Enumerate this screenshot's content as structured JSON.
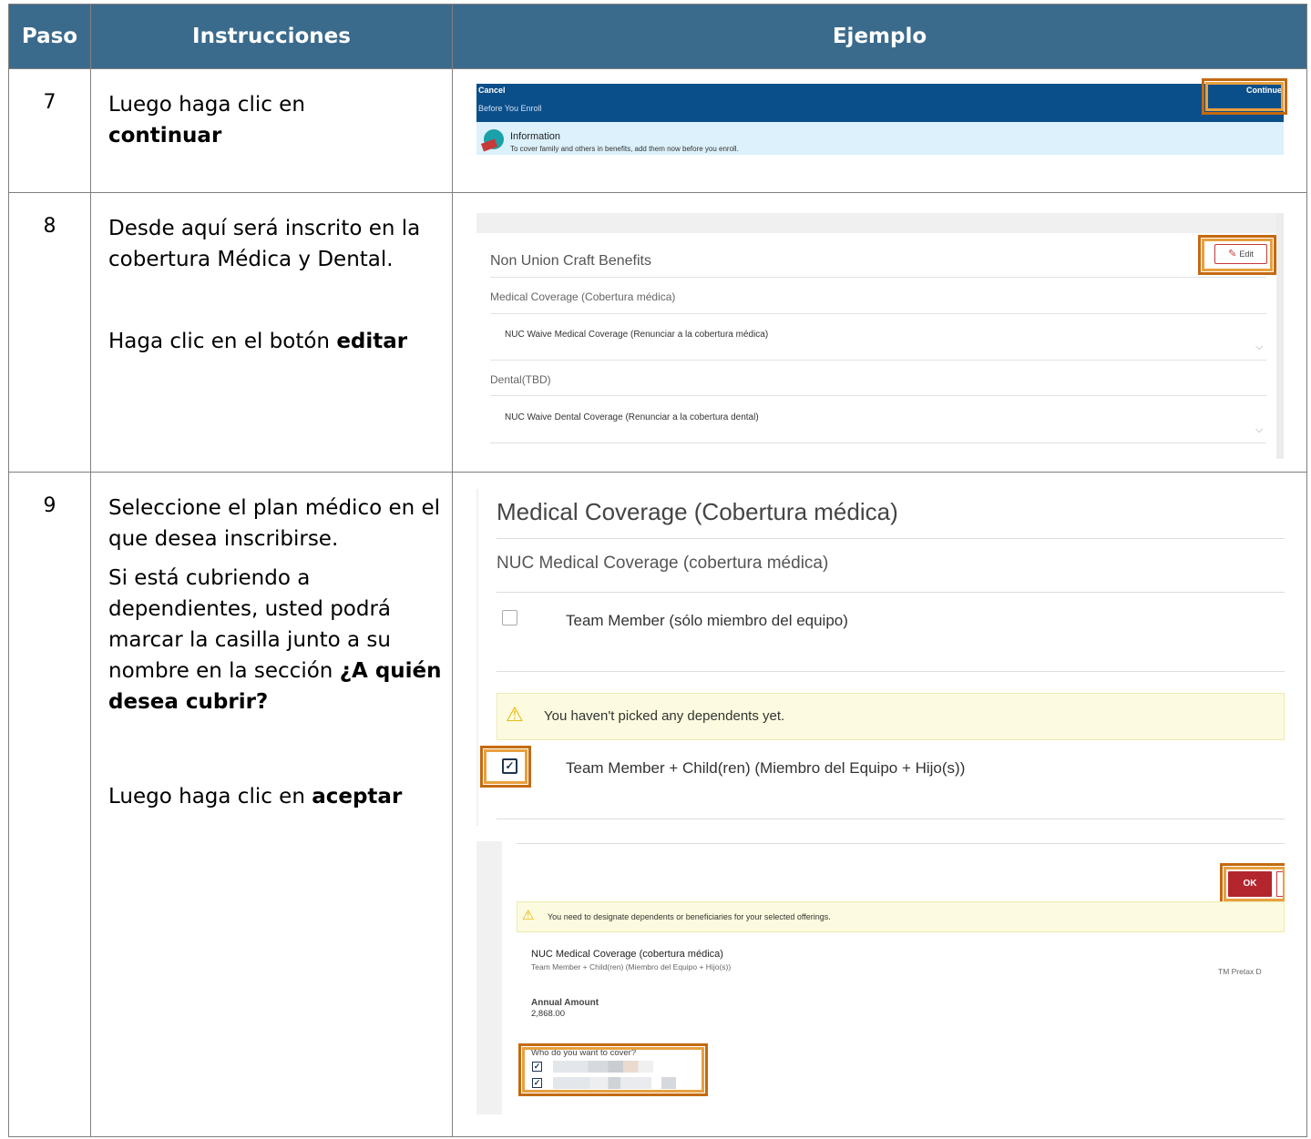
{
  "header": {
    "col_step": "Paso",
    "col_instructions": "Instrucciones",
    "col_example": "Ejemplo"
  },
  "rows": [
    {
      "step": "7",
      "instructions": {
        "line1": "Luego haga clic en",
        "bold": "continuar"
      }
    },
    {
      "step": "8",
      "instructions": {
        "para1": "Desde aquí será inscrito en la cobertura Médica y Dental.",
        "lead": "Haga clic en el botón",
        "bold": "editar"
      }
    },
    {
      "step": "9",
      "instructions": {
        "para1": "Seleccione el plan médico en el que desea inscribirse.",
        "para2_lead": "Si está cubriendo a dependientes, usted podrá marcar la casilla junto a su nombre en la sección",
        "para2_bold": "¿A quién desea cubrir?",
        "para3_lead": "Luego haga clic en",
        "para3_bold": "aceptar"
      }
    }
  ],
  "shot7": {
    "cancel": "Cancel",
    "continue": "Continue",
    "before_enroll": "Before You Enroll",
    "info_title": "Information",
    "info_text": "To cover family and others in benefits, add them now before you enroll."
  },
  "shot8": {
    "title": "Non Union Craft Benefits",
    "edit_label": "Edit",
    "medical_section": "Medical Coverage (Cobertura médica)",
    "medical_item": "NUC Waive Medical Coverage (Renunciar a la cobertura médica)",
    "dental_section": "Dental(TBD)",
    "dental_item": "NUC Waive Dental Coverage (Renunciar a la cobertura dental)"
  },
  "shot9a": {
    "heading": "Medical Coverage (Cobertura médica)",
    "plan": "NUC Medical Coverage (cobertura médica)",
    "option1": "Team Member (sólo miembro del equipo)",
    "warning": "You haven't picked any dependents yet.",
    "option2": "Team Member + Child(ren) (Miembro del Equipo + Hijo(s))",
    "option1_checked": false,
    "option2_checked": true
  },
  "shot9b": {
    "ok_label": "OK",
    "warning": "You need to designate dependents or beneficiaries for your selected offerings.",
    "plan": "NUC Medical Coverage (cobertura médica)",
    "tier": "Team Member + Child(ren) (Miembro del Equipo + Hijo(s))",
    "pretax": "TM Pretax D",
    "amount_label": "Annual Amount",
    "amount": "2,868.00",
    "who_label": "Who do you want to cover?"
  },
  "colors": {
    "header_bg": "#3b6b8c",
    "highlight": "#c46a10",
    "nav_blue": "#0b4f8a",
    "ok_red": "#b3262e"
  }
}
